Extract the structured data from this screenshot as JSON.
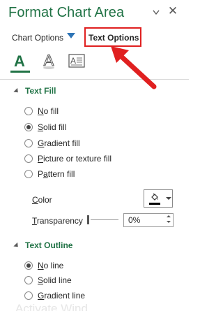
{
  "pane": {
    "title": "Format Chart Area",
    "dropdown_icon": "chevron-down-icon",
    "close_icon": "close-icon",
    "close_glyph": "✕"
  },
  "options_tabs": {
    "chart_options": "Chart Options",
    "text_options": "Text Options",
    "selected": "Text Options"
  },
  "icon_tabs": [
    {
      "name": "text-fill-outline-icon",
      "selected": true
    },
    {
      "name": "text-effects-icon",
      "selected": false
    },
    {
      "name": "textbox-icon",
      "selected": false
    }
  ],
  "text_fill": {
    "heading": "Text Fill",
    "options": [
      {
        "key": "N",
        "rest": "o fill",
        "checked": false
      },
      {
        "key": "S",
        "rest": "olid fill",
        "checked": true
      },
      {
        "key": "G",
        "rest": "radient fill",
        "checked": false
      },
      {
        "key": "P",
        "rest": "icture or texture fill",
        "checked": false
      },
      {
        "pre": "P",
        "key": "a",
        "rest": "ttern fill",
        "checked": false
      }
    ],
    "color_label_key": "C",
    "color_label_rest": "olor",
    "color_value": "#000000",
    "transparency_label_key": "T",
    "transparency_label_rest": "ransparency",
    "transparency_value": "0%"
  },
  "text_outline": {
    "heading": "Text Outline",
    "options": [
      {
        "key": "N",
        "rest": "o line",
        "checked": true
      },
      {
        "key": "S",
        "rest": "olid line",
        "checked": false
      },
      {
        "key": "G",
        "rest": "radient line",
        "checked": false
      }
    ]
  },
  "colors": {
    "accent": "#217346",
    "annotation_red": "#e02020"
  },
  "watermark": "Activate Wind"
}
